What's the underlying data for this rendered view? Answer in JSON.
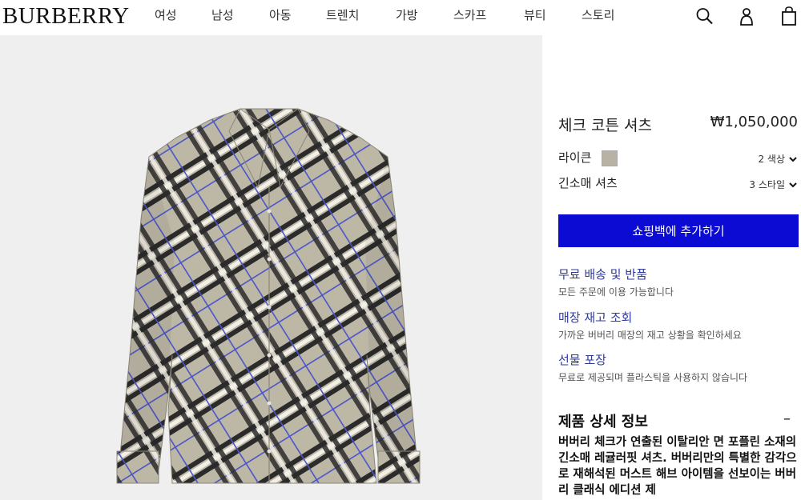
{
  "header": {
    "brand": "BURBERRY",
    "nav": [
      "여성",
      "남성",
      "아동",
      "트렌치",
      "가방",
      "스카프",
      "뷰티",
      "스토리"
    ],
    "icons": [
      "search-icon",
      "account-icon",
      "bag-icon"
    ]
  },
  "product": {
    "title": "체크 코튼 셔츠",
    "price": "₩1,050,000",
    "color": {
      "label": "라이큰",
      "swatch": "#b7b2a4",
      "count": "2 색상"
    },
    "style": {
      "label": "긴소매 셔츠",
      "count": "3 스타일"
    },
    "add_button": "쇼핑백에 추가하기"
  },
  "services": [
    {
      "title": "무료 배송 및 반품",
      "desc": "모든 주문에 이용 가능합니다"
    },
    {
      "title": "매장 재고 조회",
      "desc": "가까운 버버리 매장의 재고 상황을 확인하세요"
    },
    {
      "title": "선물 포장",
      "desc": "무료로 제공되며 플라스틱을 사용하지 않습니다"
    }
  ],
  "details": {
    "title": "제품 상세 정보",
    "toggle": "–",
    "text": "버버리 체크가 연출된 이탈리안 면 포플린 소재의 긴소매 레귤러핏 셔츠. 버버리만의 특별한 감각으로 재해석된 머스트 해브 아이템을 선보이는 버버리 클래식 에디션 제"
  },
  "colors": {
    "accent": "#0b0bd4",
    "link": "#2f3a9e",
    "gallery_bg": "#efefef"
  }
}
